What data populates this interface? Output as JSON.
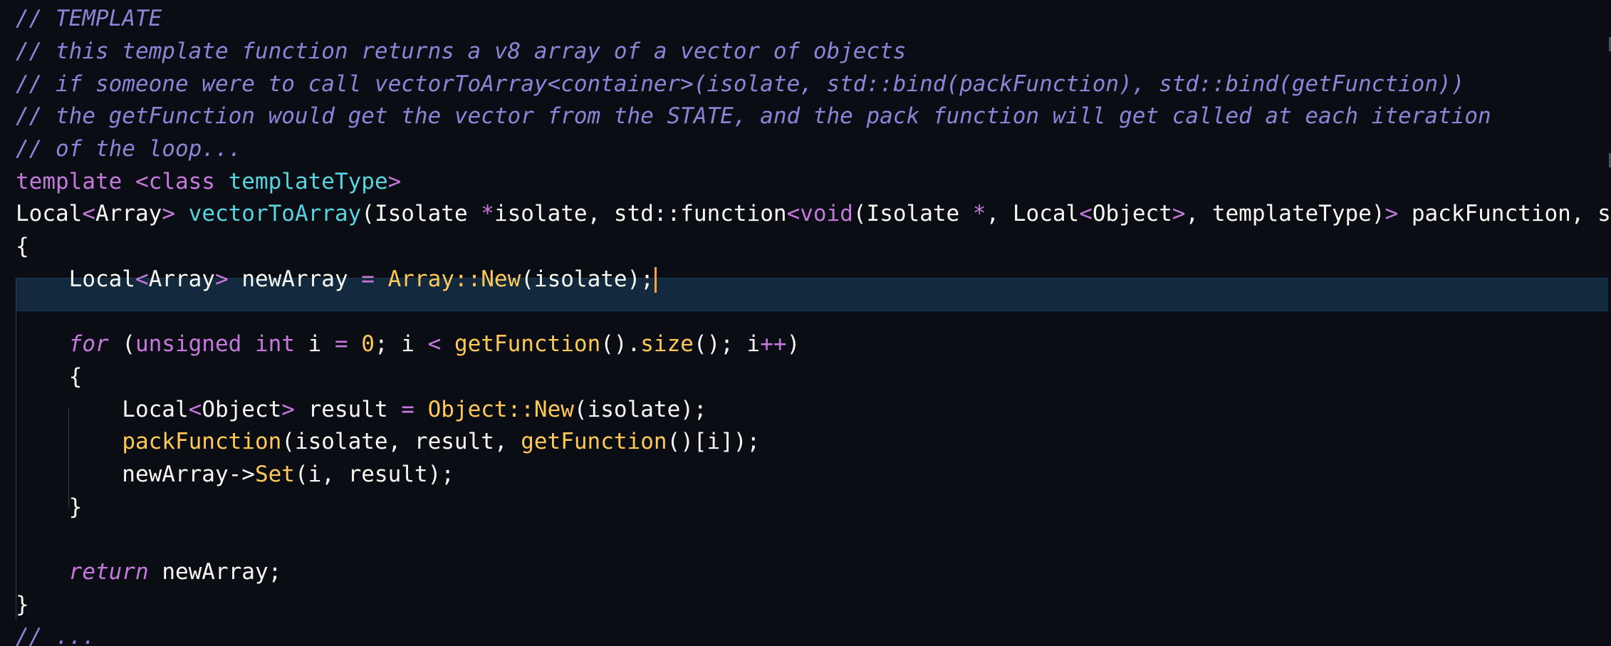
{
  "editor": {
    "lines": [
      [
        {
          "c": "cmt",
          "t": "// TEMPLATE"
        }
      ],
      [
        {
          "c": "cmt",
          "t": "// this template function returns a v8 array of a vector of objects"
        }
      ],
      [
        {
          "c": "cmt",
          "t": "// if someone were to call vectorToArray<container>(isolate, std::bind(packFunction), std::bind(getFunction))"
        }
      ],
      [
        {
          "c": "cmt",
          "t": "// the getFunction would get the vector from the STATE, and the pack function will get called at each iteration"
        }
      ],
      [
        {
          "c": "cmt",
          "t": "// of the loop..."
        }
      ],
      [
        {
          "c": "kw",
          "t": "template "
        },
        {
          "c": "op",
          "t": "<"
        },
        {
          "c": "kw",
          "t": "class "
        },
        {
          "c": "cyan",
          "t": "templateType"
        },
        {
          "c": "op",
          "t": ">"
        }
      ],
      [
        {
          "c": "plain",
          "t": "Local"
        },
        {
          "c": "op",
          "t": "<"
        },
        {
          "c": "plain",
          "t": "Array"
        },
        {
          "c": "op",
          "t": "> "
        },
        {
          "c": "cyan",
          "t": "vectorToArray"
        },
        {
          "c": "plain",
          "t": "(Isolate "
        },
        {
          "c": "op",
          "t": "*"
        },
        {
          "c": "plain",
          "t": "isolate, std::function"
        },
        {
          "c": "op",
          "t": "<"
        },
        {
          "c": "kw",
          "t": "void"
        },
        {
          "c": "plain",
          "t": "(Isolate "
        },
        {
          "c": "op",
          "t": "*"
        },
        {
          "c": "plain",
          "t": ", Local"
        },
        {
          "c": "op",
          "t": "<"
        },
        {
          "c": "plain",
          "t": "Object"
        },
        {
          "c": "op",
          "t": ">"
        },
        {
          "c": "plain",
          "t": ", templateType)"
        },
        {
          "c": "op",
          "t": "> "
        },
        {
          "c": "plain",
          "t": "packFunction, st"
        }
      ],
      [
        {
          "c": "plain",
          "t": "{"
        }
      ],
      [
        {
          "c": "plain",
          "t": "    Local"
        },
        {
          "c": "op",
          "t": "<"
        },
        {
          "c": "plain",
          "t": "Array"
        },
        {
          "c": "op",
          "t": "> "
        },
        {
          "c": "plain",
          "t": "newArray "
        },
        {
          "c": "op",
          "t": "= "
        },
        {
          "c": "fn",
          "t": "Array::New"
        },
        {
          "c": "plain",
          "t": "(isolate);"
        }
      ],
      [],
      [
        {
          "c": "plain",
          "t": "    "
        },
        {
          "c": "kwi",
          "t": "for "
        },
        {
          "c": "plain",
          "t": "("
        },
        {
          "c": "kw",
          "t": "unsigned int "
        },
        {
          "c": "plain",
          "t": "i "
        },
        {
          "c": "op",
          "t": "= "
        },
        {
          "c": "num",
          "t": "0"
        },
        {
          "c": "plain",
          "t": "; i "
        },
        {
          "c": "op",
          "t": "< "
        },
        {
          "c": "fn",
          "t": "getFunction"
        },
        {
          "c": "plain",
          "t": "()."
        },
        {
          "c": "fn",
          "t": "size"
        },
        {
          "c": "plain",
          "t": "(); i"
        },
        {
          "c": "op",
          "t": "++"
        },
        {
          "c": "plain",
          "t": ")"
        }
      ],
      [
        {
          "c": "plain",
          "t": "    {"
        }
      ],
      [
        {
          "c": "plain",
          "t": "        Local"
        },
        {
          "c": "op",
          "t": "<"
        },
        {
          "c": "plain",
          "t": "Object"
        },
        {
          "c": "op",
          "t": "> "
        },
        {
          "c": "plain",
          "t": "result "
        },
        {
          "c": "op",
          "t": "= "
        },
        {
          "c": "fn",
          "t": "Object::New"
        },
        {
          "c": "plain",
          "t": "(isolate);"
        }
      ],
      [
        {
          "c": "plain",
          "t": "        "
        },
        {
          "c": "fn",
          "t": "packFunction"
        },
        {
          "c": "plain",
          "t": "(isolate, result, "
        },
        {
          "c": "fn",
          "t": "getFunction"
        },
        {
          "c": "plain",
          "t": "()[i]);"
        }
      ],
      [
        {
          "c": "plain",
          "t": "        newArray->"
        },
        {
          "c": "fn",
          "t": "Set"
        },
        {
          "c": "plain",
          "t": "(i, result);"
        }
      ],
      [
        {
          "c": "plain",
          "t": "    }"
        }
      ],
      [],
      [
        {
          "c": "plain",
          "t": "    "
        },
        {
          "c": "kwi",
          "t": "return "
        },
        {
          "c": "plain",
          "t": "newArray;"
        }
      ],
      [
        {
          "c": "plain",
          "t": "}"
        }
      ],
      [
        {
          "c": "cmt",
          "t": "// ... "
        }
      ]
    ],
    "active_line": 9,
    "colors": {
      "background": "#0a0e14",
      "active_line": "#13293d",
      "comment": "#8a85d6",
      "keyword": "#c678dd",
      "function": "#ffc857",
      "type": "#56d4e0",
      "cursor": "#ffa040"
    }
  }
}
